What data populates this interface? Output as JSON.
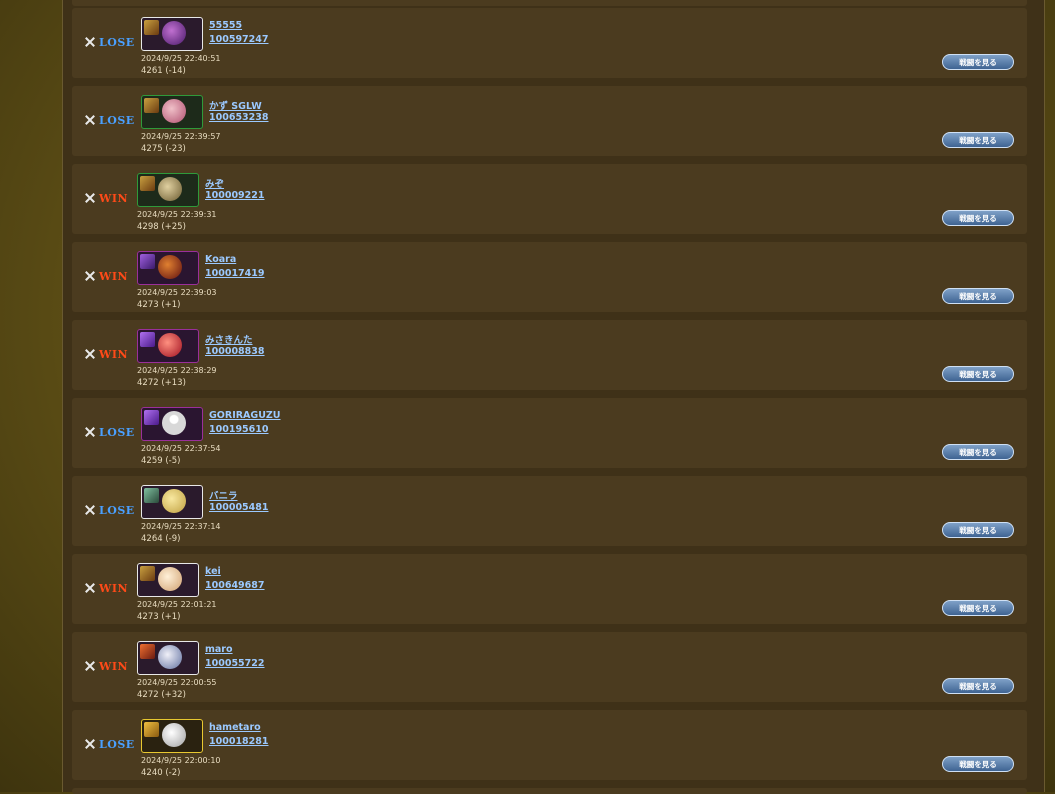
{
  "colors": {
    "lose": "#4aa0ff",
    "win": "#ff4a18",
    "link": "#9bc9ff",
    "card_bg": "#4b3b1f",
    "button": "#5a7fb0"
  },
  "battles": [
    {
      "result": "LOSE",
      "name": "55555",
      "id": "100597247",
      "date": "2024/9/25 22:40:51",
      "score": "4261 (-14)",
      "button": "戦闘を見る"
    },
    {
      "result": "LOSE",
      "name": "かず SGLW",
      "id": "100653238",
      "date": "2024/9/25 22:39:57",
      "score": "4275 (-23)",
      "button": "戦闘を見る"
    },
    {
      "result": "WIN",
      "name": "みぞ",
      "id": "100009221",
      "date": "2024/9/25 22:39:31",
      "score": "4298 (+25)",
      "button": "戦闘を見る"
    },
    {
      "result": "WIN",
      "name": "Koara",
      "id": "100017419",
      "date": "2024/9/25 22:39:03",
      "score": "4273 (+1)",
      "button": "戦闘を見る"
    },
    {
      "result": "WIN",
      "name": "みさきんた",
      "id": "100008838",
      "date": "2024/9/25 22:38:29",
      "score": "4272 (+13)",
      "button": "戦闘を見る"
    },
    {
      "result": "LOSE",
      "name": "GORIRAGUZU",
      "id": "100195610",
      "date": "2024/9/25 22:37:54",
      "score": "4259 (-5)",
      "button": "戦闘を見る"
    },
    {
      "result": "LOSE",
      "name": "バニラ",
      "id": "100005481",
      "date": "2024/9/25 22:37:14",
      "score": "4264 (-9)",
      "button": "戦闘を見る"
    },
    {
      "result": "WIN",
      "name": "kei",
      "id": "100649687",
      "date": "2024/9/25 22:01:21",
      "score": "4273 (+1)",
      "button": "戦闘を見る"
    },
    {
      "result": "WIN",
      "name": "maro",
      "id": "100055722",
      "date": "2024/9/25 22:00:55",
      "score": "4272 (+32)",
      "button": "戦闘を見る"
    },
    {
      "result": "LOSE",
      "name": "hametaro",
      "id": "100018281",
      "date": "2024/9/25 22:00:10",
      "score": "4240 (-2)",
      "button": "戦闘を見る"
    }
  ]
}
